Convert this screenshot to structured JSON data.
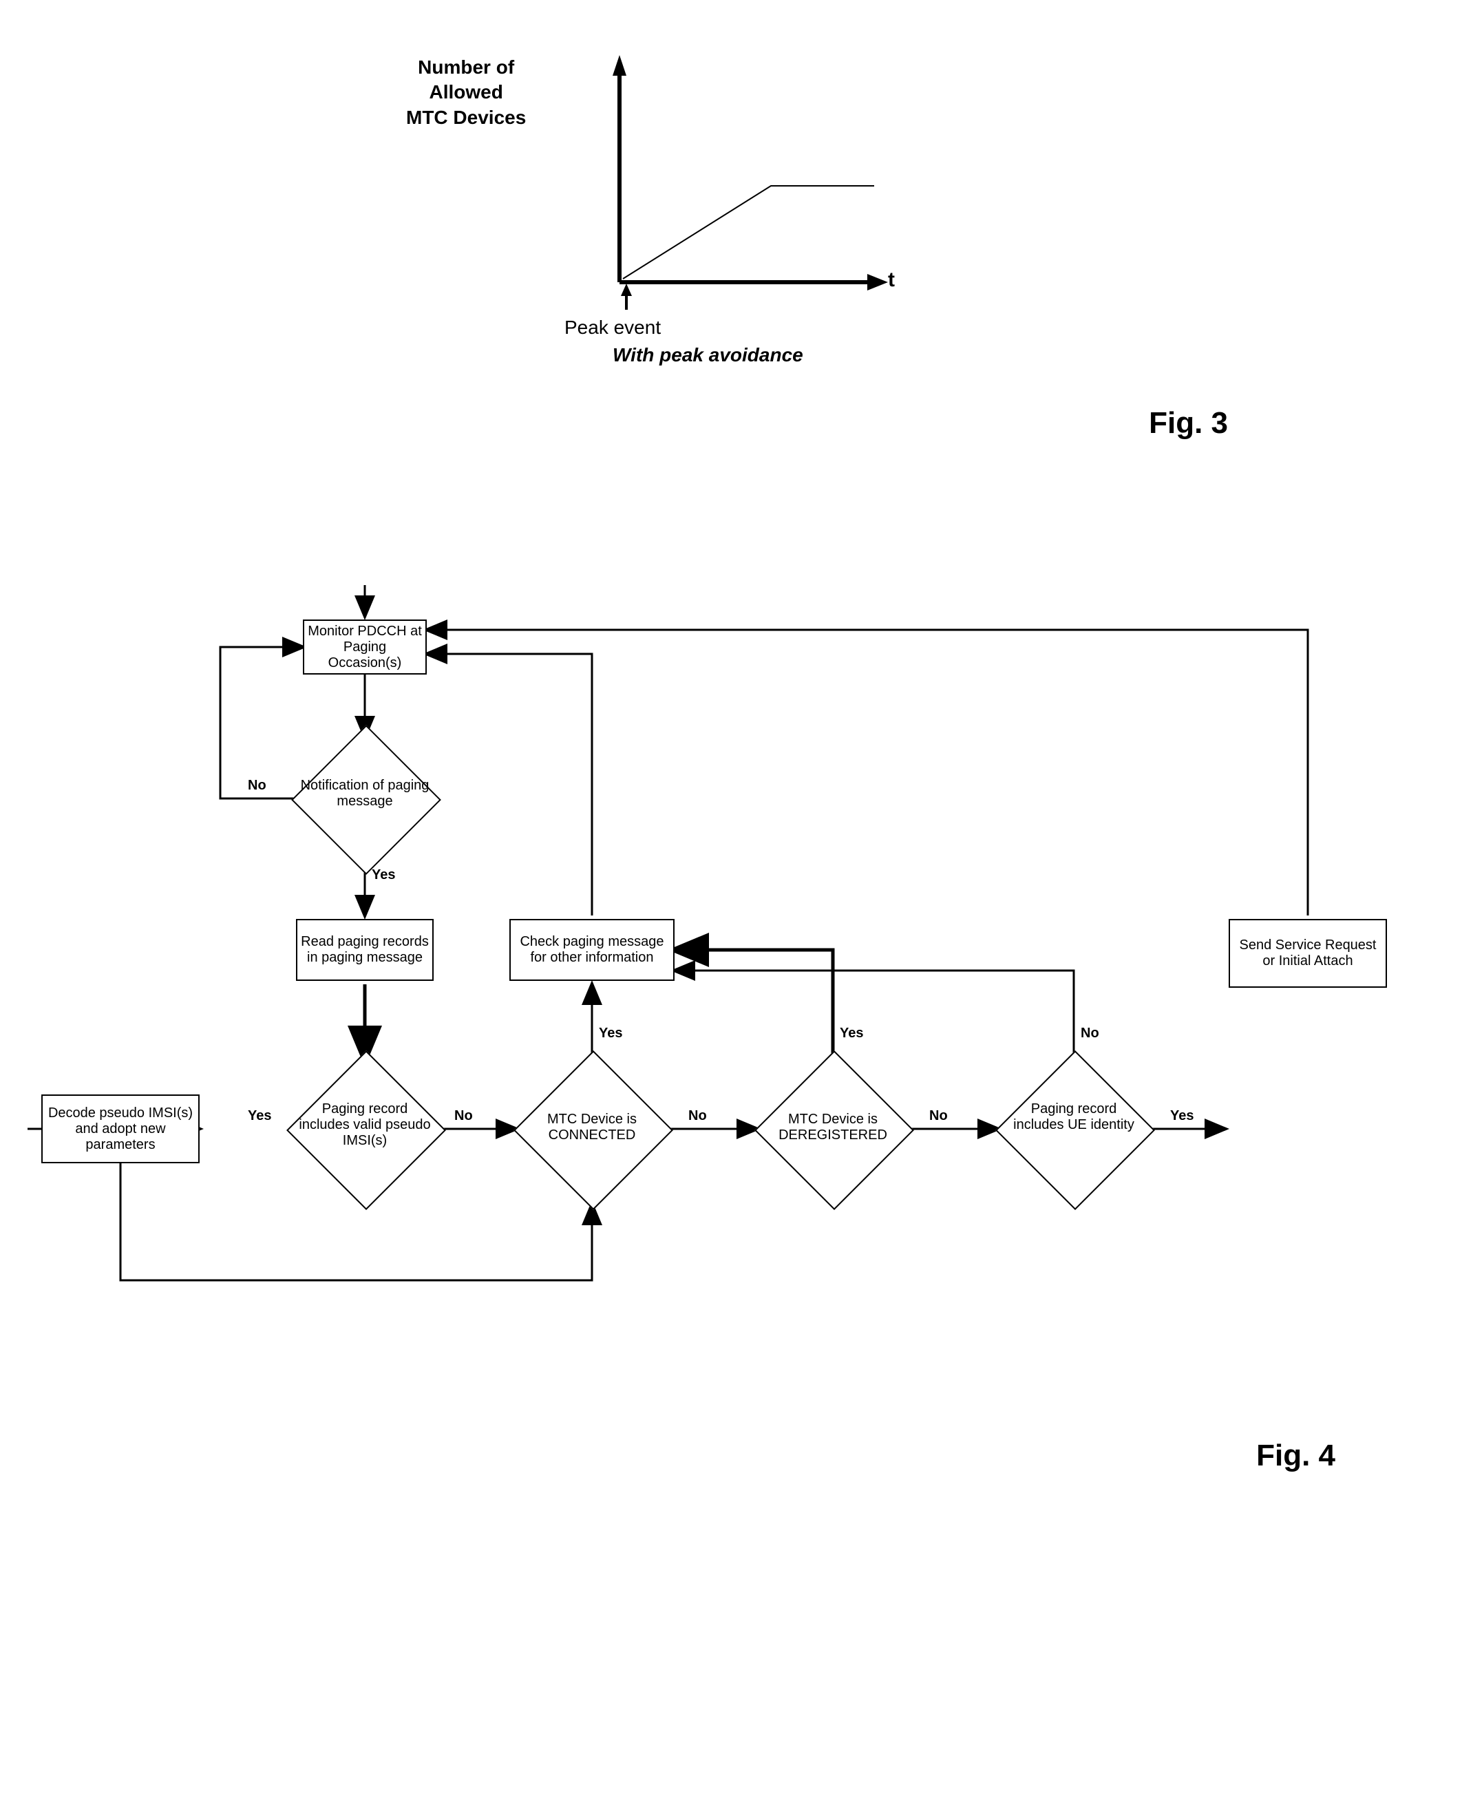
{
  "fig3": {
    "y_axis_label": "Number of\nAllowed\nMTC Devices",
    "x_axis_label": "t",
    "peak_event": "Peak event",
    "peak_avoidance": "With peak avoidance",
    "title": "Fig. 3"
  },
  "fig4": {
    "title": "Fig. 4",
    "boxes": {
      "monitor": "Monitor PDCCH at Paging Occasion(s)",
      "read_paging": "Read paging records in paging message",
      "check_paging": "Check paging message for other information",
      "service_request": "Send Service Request or Initial Attach",
      "decode": "Decode pseudo IMSI(s) and adopt new parameters"
    },
    "diamonds": {
      "notification": "Notification of paging message",
      "valid_imsi": "Paging record includes valid pseudo IMSI(s)",
      "connected": "MTC Device is CONNECTED",
      "deregistered": "MTC Device is DEREGISTERED",
      "ue_identity": "Paging record includes UE identity"
    },
    "labels": {
      "yes": "Yes",
      "no": "No"
    }
  }
}
